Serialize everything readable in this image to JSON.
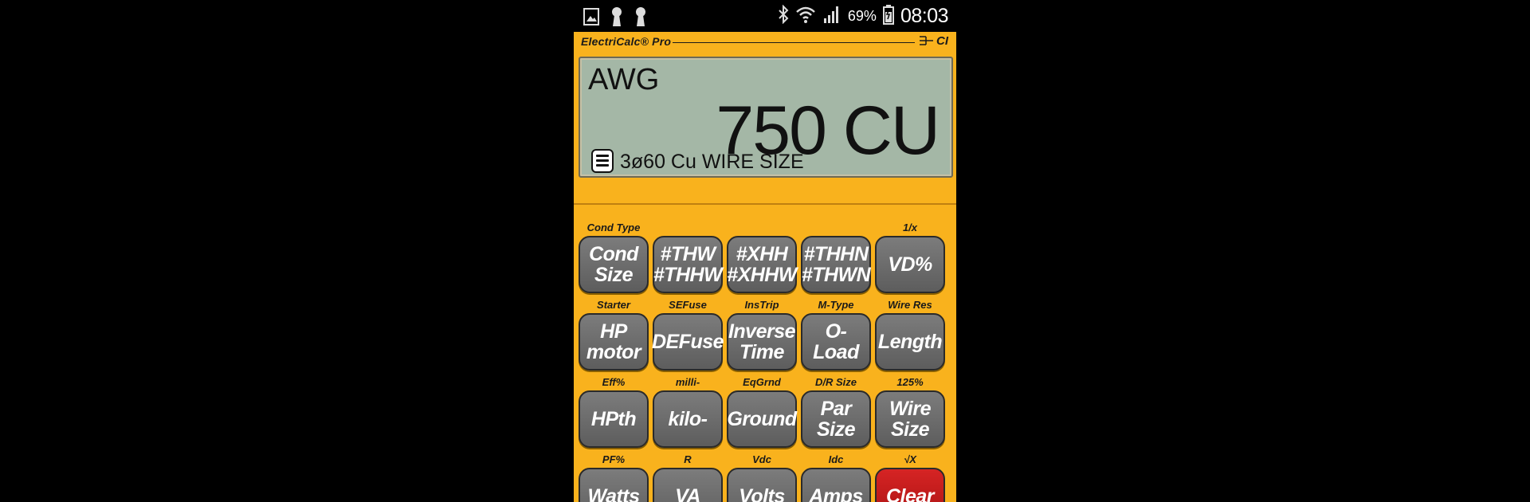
{
  "status_bar": {
    "left_icons": [
      "gallery-icon",
      "keyhole-icon",
      "keyhole-icon"
    ],
    "right_icons": [
      "bluetooth-icon",
      "wifi-icon",
      "signal-icon",
      "battery-icon"
    ],
    "battery_percent": "69%",
    "time": "08:03"
  },
  "app": {
    "brand": "ElectriCalc® Pro",
    "logo": "CI"
  },
  "display": {
    "unit": "AWG",
    "value": "750 CU",
    "status": "3ø60 Cu WIRE SIZE"
  },
  "keypad": {
    "rows": [
      [
        {
          "shift": "Cond Type",
          "label": "Cond\nSize"
        },
        {
          "shift": "",
          "label": "#THW\n#THHW"
        },
        {
          "shift": "",
          "label": "#XHH\n#XHHW"
        },
        {
          "shift": "",
          "label": "#THHN\n#THWN"
        },
        {
          "shift": "1/x",
          "label": "VD%"
        }
      ],
      [
        {
          "shift": "Starter",
          "label": "HP\nmotor"
        },
        {
          "shift": "SEFuse",
          "label": "DEFuse"
        },
        {
          "shift": "InsTrip",
          "label": "Inverse\nTime"
        },
        {
          "shift": "M-Type",
          "label": "O-Load"
        },
        {
          "shift": "Wire Res",
          "label": "Length"
        }
      ],
      [
        {
          "shift": "Eff%",
          "label": "HPth"
        },
        {
          "shift": "milli-",
          "label": "kilo-"
        },
        {
          "shift": "EqGrnd",
          "label": "Ground"
        },
        {
          "shift": "D/R Size",
          "label": "Par Size"
        },
        {
          "shift": "125%",
          "label": "Wire\nSize"
        }
      ],
      [
        {
          "shift": "PF%",
          "label": "Watts"
        },
        {
          "shift": "R",
          "label": "VA"
        },
        {
          "shift": "Vdc",
          "label": "Volts"
        },
        {
          "shift": "Idc",
          "label": "Amps"
        },
        {
          "shift": "√X",
          "label": "Clear"
        }
      ]
    ]
  },
  "colors": {
    "body": "#f9b21d",
    "lcd": "#a4b7a6",
    "key": "#6b6b6b",
    "clear_key": "#c81b1b"
  }
}
